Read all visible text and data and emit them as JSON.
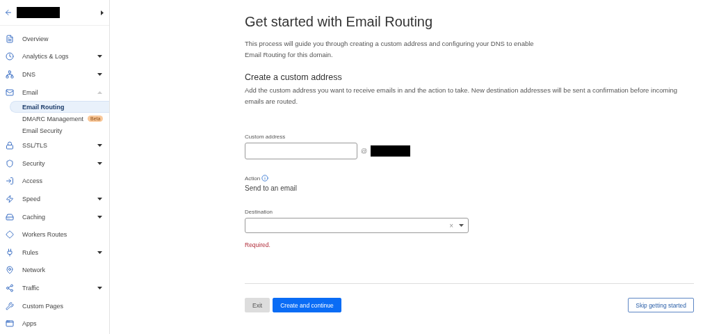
{
  "sidebar": {
    "items": [
      {
        "label": "Overview"
      },
      {
        "label": "Analytics & Logs",
        "expanded": false
      },
      {
        "label": "DNS",
        "expanded": false
      },
      {
        "label": "Email",
        "expanded": true,
        "children": [
          {
            "label": "Email Routing",
            "selected": true
          },
          {
            "label": "DMARC Management",
            "selected": false,
            "badge": "Beta"
          },
          {
            "label": "Email Security",
            "selected": false
          }
        ]
      },
      {
        "label": "SSL/TLS",
        "expanded": false
      },
      {
        "label": "Security",
        "expanded": false
      },
      {
        "label": "Access"
      },
      {
        "label": "Speed",
        "expanded": false
      },
      {
        "label": "Caching",
        "expanded": false
      },
      {
        "label": "Workers Routes"
      },
      {
        "label": "Rules",
        "expanded": false
      },
      {
        "label": "Network"
      },
      {
        "label": "Traffic",
        "expanded": false
      },
      {
        "label": "Custom Pages"
      },
      {
        "label": "Apps"
      }
    ]
  },
  "main": {
    "title": "Get started with Email Routing",
    "intro": "This process will guide you through creating a custom address and configuring your DNS to enable Email Routing for this domain.",
    "section_title": "Create a custom address",
    "section_text": "Add the custom address you want to receive emails in and the action to take. New destination addresses will be sent a confirmation before incoming emails are routed.",
    "custom_address": {
      "label": "Custom address",
      "at": "@"
    },
    "action": {
      "label": "Action",
      "value": "Send to an email"
    },
    "destination": {
      "label": "Destination",
      "clear": "×",
      "error": "Required."
    },
    "buttons": [
      {
        "label": "Exit",
        "kind": "secondary"
      },
      {
        "label": "Create and continue",
        "kind": "primary"
      },
      {
        "label": "Skip getting started",
        "kind": "outline"
      }
    ]
  }
}
